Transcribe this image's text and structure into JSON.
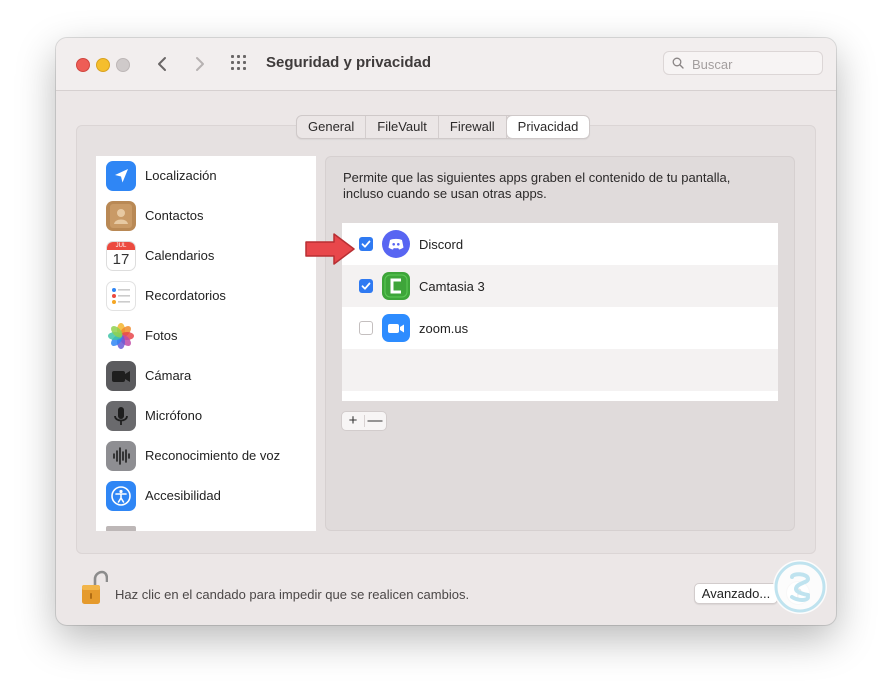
{
  "window": {
    "title": "Seguridad y privacidad",
    "search_placeholder": "Buscar"
  },
  "tabs": [
    {
      "label": "General",
      "active": false
    },
    {
      "label": "FileVault",
      "active": false
    },
    {
      "label": "Firewall",
      "active": false
    },
    {
      "label": "Privacidad",
      "active": true
    }
  ],
  "sidebar": {
    "items": [
      {
        "label": "Localización",
        "icon": "location-arrow-icon"
      },
      {
        "label": "Contactos",
        "icon": "contacts-icon"
      },
      {
        "label": "Calendarios",
        "icon": "calendar-icon",
        "icon_month": "JUL",
        "icon_day": "17"
      },
      {
        "label": "Recordatorios",
        "icon": "reminders-icon"
      },
      {
        "label": "Fotos",
        "icon": "photos-icon"
      },
      {
        "label": "Cámara",
        "icon": "camera-icon"
      },
      {
        "label": "Micrófono",
        "icon": "microphone-icon"
      },
      {
        "label": "Reconocimiento de voz",
        "icon": "speech-recognition-icon"
      },
      {
        "label": "Accesibilidad",
        "icon": "accessibility-icon"
      }
    ]
  },
  "main": {
    "description": "Permite que las siguientes apps graben el contenido de tu pantalla, incluso cuando se usan otras apps.",
    "apps": [
      {
        "name": "Discord",
        "checked": true,
        "icon": "discord-icon"
      },
      {
        "name": "Camtasia 3",
        "checked": true,
        "icon": "camtasia-icon"
      },
      {
        "name": "zoom.us",
        "checked": false,
        "icon": "zoom-icon"
      }
    ],
    "add_label": "+",
    "remove_label": "—"
  },
  "footer": {
    "lock_text": "Haz clic en el candado para impedir que se realicen cambios.",
    "advanced_label": "Avanzado...",
    "help_label": "?"
  },
  "colors": {
    "accent": "#2f7af2",
    "annotation_arrow": "#e8474b"
  }
}
